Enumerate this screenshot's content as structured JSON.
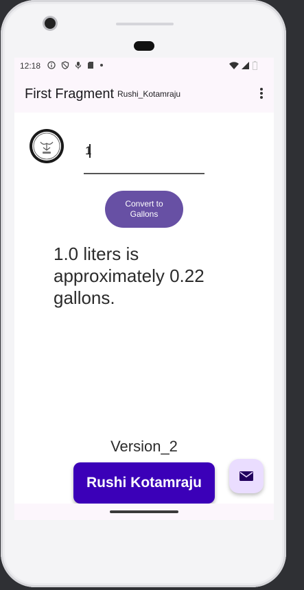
{
  "status_bar": {
    "time": "12:18",
    "left_icons": [
      "info-icon",
      "shield-icon",
      "mic-icon",
      "sd-card-icon",
      "dot-icon"
    ],
    "right_icons": [
      "wifi-icon",
      "signal-icon",
      "battery-icon"
    ]
  },
  "app_bar": {
    "title": "First Fragment",
    "subtitle": "Rushi_Kotamraju",
    "overflow_icon": "more-vert-icon"
  },
  "form": {
    "logo_icon": "emblem-logo",
    "liters_input_value": "1",
    "convert_button_label": "Convert to\nGallons"
  },
  "result": {
    "text": "1.0 liters is approximately 0.22 gallons."
  },
  "footer": {
    "version_text": "Version_2",
    "name_button_label": "Rushi Kotamraju",
    "fab_icon": "mail-icon"
  },
  "colors": {
    "primary": "#6750a4",
    "name_button": "#3b00b8",
    "fab_bg": "#eaddff",
    "surface": "#fcf6fc"
  }
}
